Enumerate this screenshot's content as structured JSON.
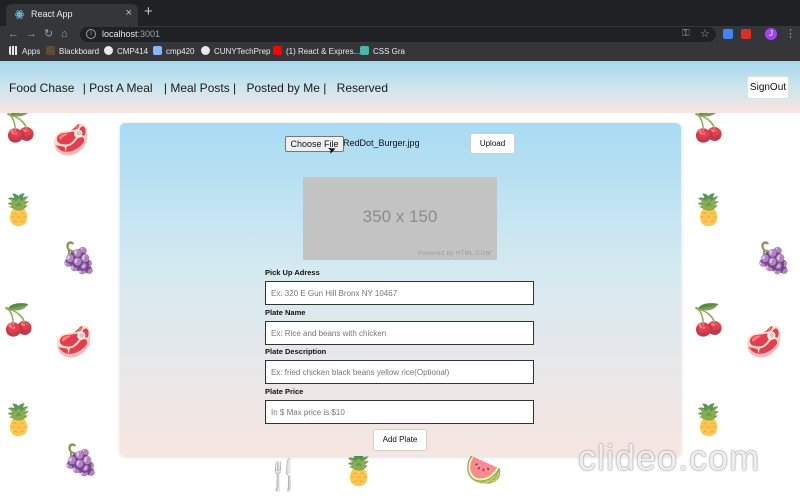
{
  "browser": {
    "tab_title": "React App",
    "tab_close": "×",
    "new_tab": "+",
    "url_host": "localhost",
    "url_port": ":3001",
    "profile_initial": "J",
    "bookmarks": [
      "Apps",
      "Blackboard",
      "CMP414",
      "cmp420",
      "CUNYTechPrep",
      "(1) React & Expres...",
      "CSS Gra"
    ]
  },
  "navbar": {
    "links": [
      "Food Chase",
      "| Post A Meal",
      "| Meal Posts |",
      "Posted by Me |",
      "Reserved"
    ],
    "signout": "SignOut"
  },
  "upload": {
    "choose_file": "Choose File",
    "file_name": "RedDot_Burger.jpg",
    "upload_button": "Upload"
  },
  "image_placeholder": {
    "size_text": "350 x 150",
    "powered_by": "Powered by HTML.COM"
  },
  "form": {
    "pickup_label": "Pick Up Adress",
    "pickup_placeholder": "Ex: 320 E Gun Hill Bronx NY 10467",
    "name_label": "Plate Name",
    "name_placeholder": "Ex: Rice and beans with chicken",
    "description_label": "Plate Description",
    "description_placeholder": "Ex: fried chicken black beans yellow rice(Optional)",
    "price_label": "Plate Price",
    "price_placeholder": "In $ Max price is $10",
    "add_button": "Add Plate"
  },
  "overlay": {
    "watermark": "clideo.com",
    "close": "×"
  },
  "colors": {
    "nav_top": "#a8d8ee",
    "nav_bottom": "#fbe4e0",
    "card_top": "#a8dbf3",
    "card_bottom": "#f7e5e0"
  }
}
